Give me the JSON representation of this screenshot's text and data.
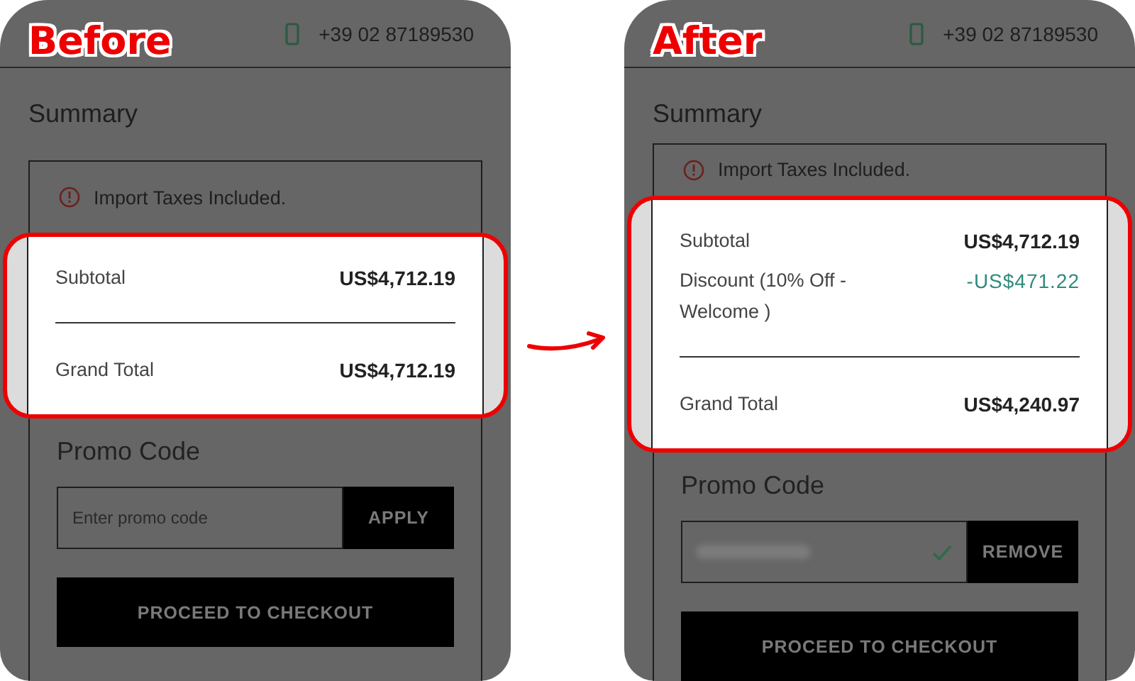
{
  "panels": [
    {
      "label": "Before",
      "phone": "+39 02 87189530",
      "title": "Summary",
      "notice": "Import Taxes Included.",
      "lines": [
        {
          "kind": "amount",
          "label": "Subtotal",
          "value": "US$4,712.19"
        }
      ],
      "total": {
        "label": "Grand Total",
        "value": "US$4,712.19"
      },
      "promo": {
        "title": "Promo Code",
        "placeholder": "Enter promo code",
        "applied": false,
        "button": "APPLY"
      },
      "checkout": "PROCEED TO CHECKOUT"
    },
    {
      "label": "After",
      "phone": "+39 02 87189530",
      "title": "Summary",
      "notice": "Import Taxes Included.",
      "lines": [
        {
          "kind": "amount",
          "label": "Subtotal",
          "value": "US$4,712.19"
        },
        {
          "kind": "discount",
          "label": "Discount (10% Off - Welcome )",
          "value": "-US$471.22"
        }
      ],
      "total": {
        "label": "Grand Total",
        "value": "US$4,240.97"
      },
      "promo": {
        "title": "Promo Code",
        "applied": true,
        "button": "REMOVE"
      },
      "checkout": "PROCEED TO CHECKOUT"
    }
  ]
}
